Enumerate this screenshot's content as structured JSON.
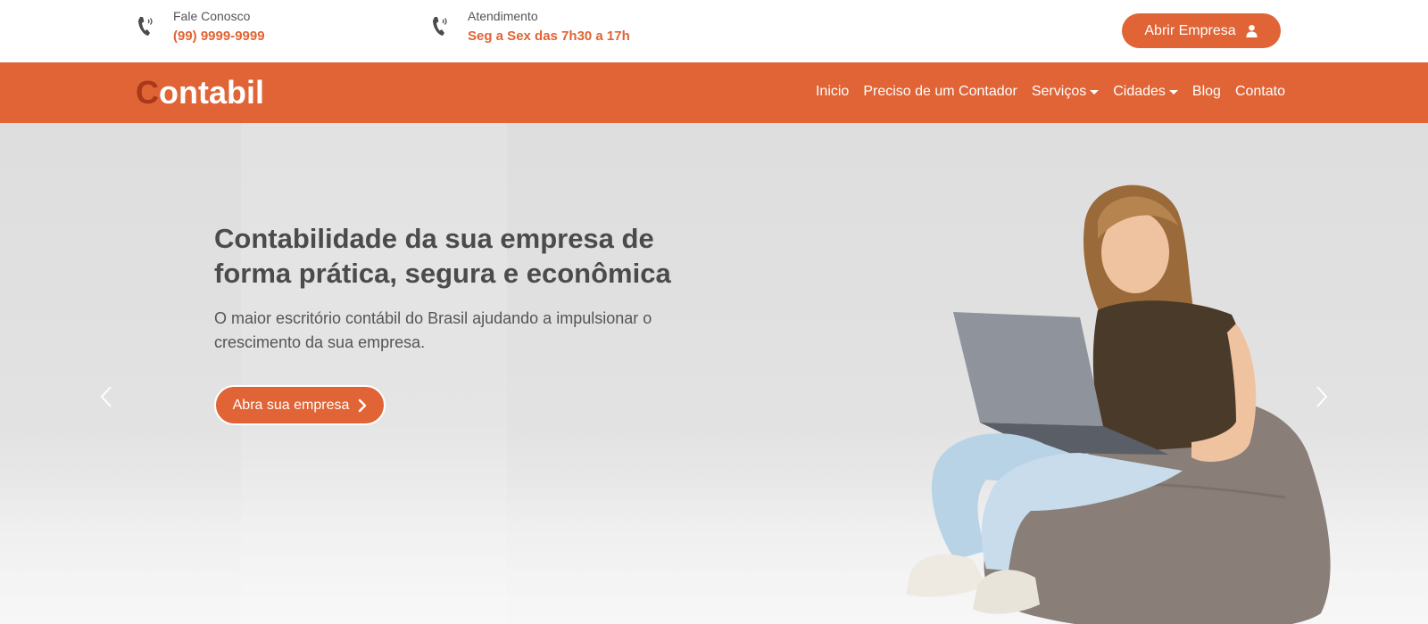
{
  "topbar": {
    "contact_phone": {
      "label": "Fale Conosco",
      "value": "(99) 9999-9999",
      "icon": "phone-icon"
    },
    "contact_hours": {
      "label": "Atendimento",
      "value": "Seg a Sex das 7h30 a 17h",
      "icon": "phone-icon"
    },
    "cta_label": "Abrir Empresa",
    "cta_icon": "user-icon"
  },
  "navbar": {
    "logo_first": "C",
    "logo_rest": "ontabil",
    "items": [
      {
        "label": "Inicio"
      },
      {
        "label": "Preciso de um Contador"
      },
      {
        "label": "Serviços",
        "dropdown": true
      },
      {
        "label": "Cidades",
        "dropdown": true
      },
      {
        "label": "Blog"
      },
      {
        "label": "Contato"
      }
    ]
  },
  "hero": {
    "title": "Contabilidade da sua empresa de forma prática, segura e econômica",
    "subtitle": "O maior escritório contábil do Brasil ajudando a impulsionar o crescimento da sua empresa.",
    "button_label": "Abra sua empresa",
    "prev_icon": "chevron-left-icon",
    "next_icon": "chevron-right-icon"
  },
  "colors": {
    "accent": "#e06435",
    "logo_c": "#a9381c",
    "text_dark": "#4b4b4b"
  }
}
